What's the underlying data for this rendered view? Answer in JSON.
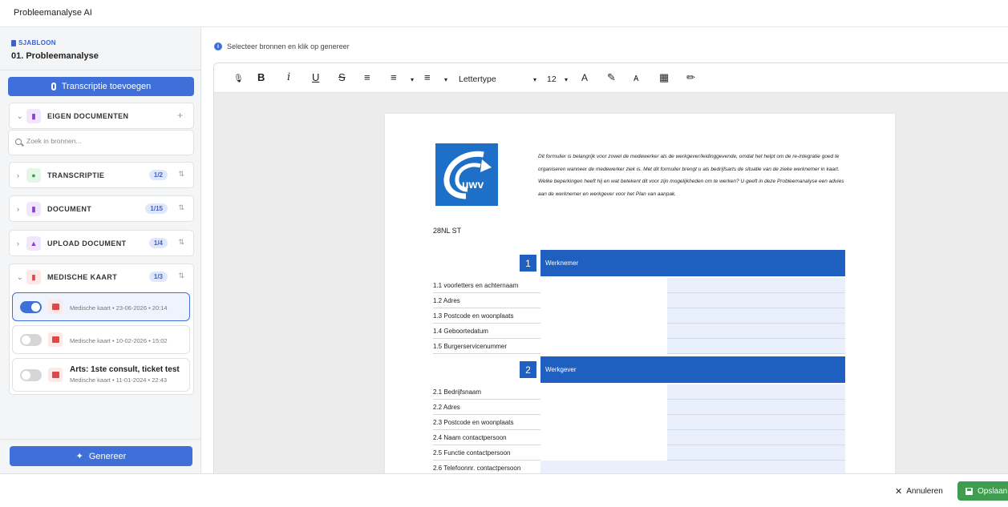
{
  "app": {
    "title": "Probleemanalyse AI"
  },
  "sidebar": {
    "template_tag": "SJABLOON",
    "template_name": "01. Probleemanalyse",
    "transcript_button": "Transcriptie toevoegen",
    "own_documents": {
      "label": "EIGEN DOCUMENTEN",
      "add": "+"
    },
    "search": {
      "placeholder": "Zoek in bronnen..."
    },
    "sections": [
      {
        "label": "TRANSCRIPTIE",
        "badge": "1/2",
        "icon": "mic-icon",
        "color": "#2fa84f",
        "bg": "#e5f6e9"
      },
      {
        "label": "DOCUMENT",
        "badge": "1/15",
        "icon": "document-icon",
        "color": "#8a3fd1",
        "bg": "#f1e6fb"
      },
      {
        "label": "UPLOAD DOCUMENT",
        "badge": "1/4",
        "icon": "upload-icon",
        "color": "#8a3fd1",
        "bg": "#f1e6fb"
      },
      {
        "label": "MEDISCHE KAART",
        "badge": "1/3",
        "icon": "medical-icon",
        "color": "#e04848",
        "bg": "#fde7e7"
      }
    ],
    "medical_items": [
      {
        "text": "Medische kaart • 23-06-2026 • 20:14",
        "on": true
      },
      {
        "text": "Medische kaart • 10-02-2026 • 15:02",
        "on": false
      },
      {
        "title": "Arts: 1ste consult, ticket test",
        "text": "Medische kaart • 11-01-2024 • 22:43",
        "on": false
      }
    ],
    "generate_button": "Genereer"
  },
  "main": {
    "info": "Selecteer bronnen en klik op genereer",
    "toolbar": {
      "font": "Lettertype",
      "size": "12",
      "bold": "B",
      "italic": "i",
      "underline": "U",
      "strike": "S"
    },
    "document": {
      "intro": "Dit formulier is belangrijk voor zowel de medewerker als de werkgever/leidinggevende, omdat het helpt om de re-integratie goed te organiseren wanneer de medewerker ziek is. Met dit formulier brengt u als bedrijfsarts de situatie van de zieke werknemer in kaart. Welke beperkingen heeft hij en wat betekent dit voor zijn mogelijkheden om te werken? U geeft in deze Probleemanalyse een advies aan de werknemer en werkgever voor het Plan van aanpak.",
      "logo_text": "uwv",
      "code": "28NL ST",
      "section1": {
        "num": "1",
        "title": "Werknemer",
        "rows": [
          "1.1 voorletters en achternaam",
          "1.2 Adres",
          "1.3 Postcode en woonplaats",
          "1.4 Geboortedatum",
          "1.5 Burgerservicenummer"
        ]
      },
      "section2": {
        "num": "2",
        "title": "Werkgever",
        "rows": [
          "2.1 Bedrijfsnaam",
          "2.2 Adres",
          "2.3 Postcode en woonplaats",
          "2.4 Naam contactpersoon",
          "2.5 Functie contactpersoon",
          "2.6 Telefoonnr. contactpersoon"
        ]
      }
    }
  },
  "footer": {
    "cancel": "Annuleren",
    "save": "Opslaan"
  }
}
